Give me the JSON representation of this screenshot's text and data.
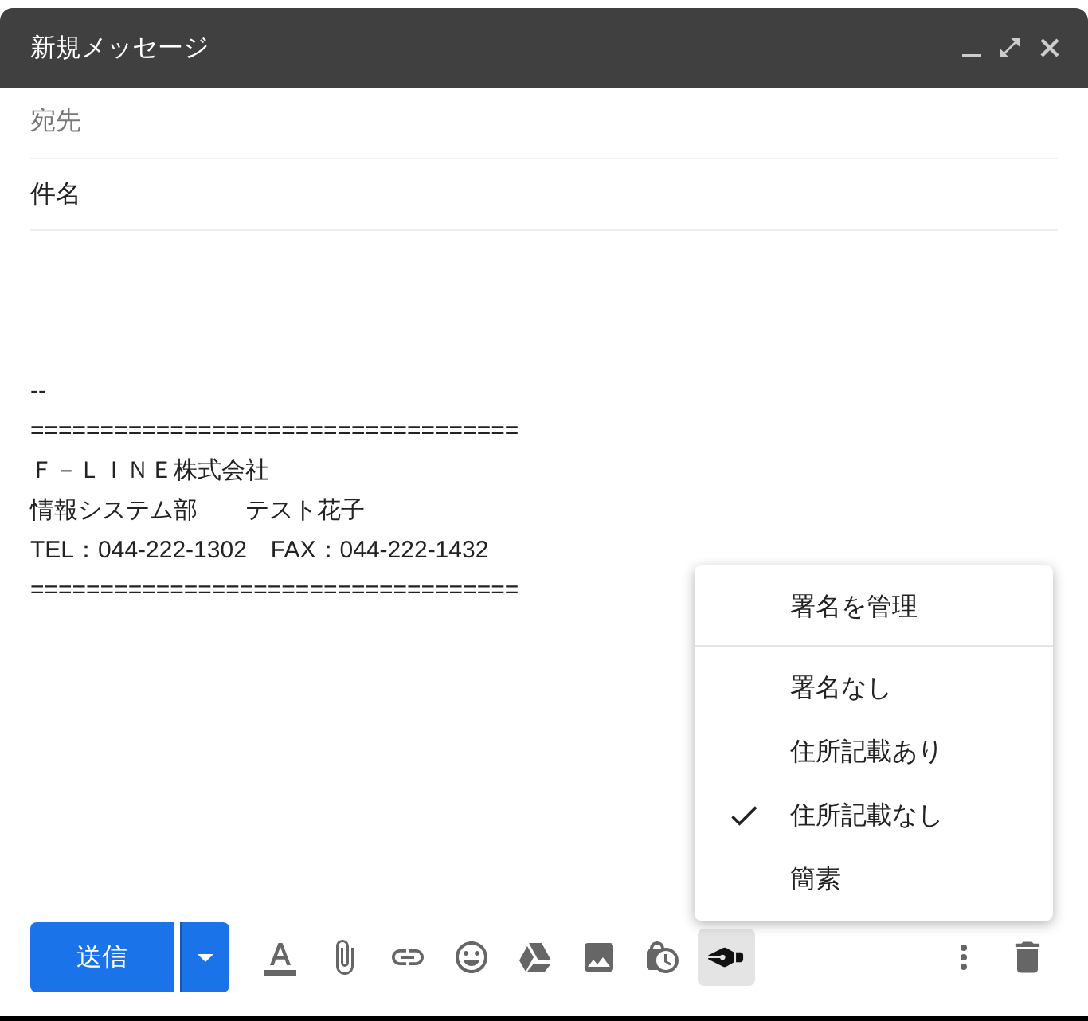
{
  "window": {
    "title": "新規メッセージ"
  },
  "fields": {
    "to": {
      "placeholder": "宛先"
    },
    "subject": {
      "value": "件名"
    }
  },
  "body_lines": [
    "--",
    "===================================",
    "Ｆ－ＬＩＮＥ株式会社",
    "情報システム部　　テスト花子",
    "TEL：044-222-1302　FAX：044-222-1432",
    "==================================="
  ],
  "toolbar": {
    "send": "送信",
    "signature_active": true
  },
  "signature_menu": [
    {
      "kind": "action",
      "label": "署名を管理",
      "selected": false
    },
    {
      "kind": "option",
      "label": "署名なし",
      "selected": false
    },
    {
      "kind": "option",
      "label": "住所記載あり",
      "selected": false
    },
    {
      "kind": "option",
      "label": "住所記載なし",
      "selected": true
    },
    {
      "kind": "option",
      "label": "簡素",
      "selected": false
    }
  ]
}
